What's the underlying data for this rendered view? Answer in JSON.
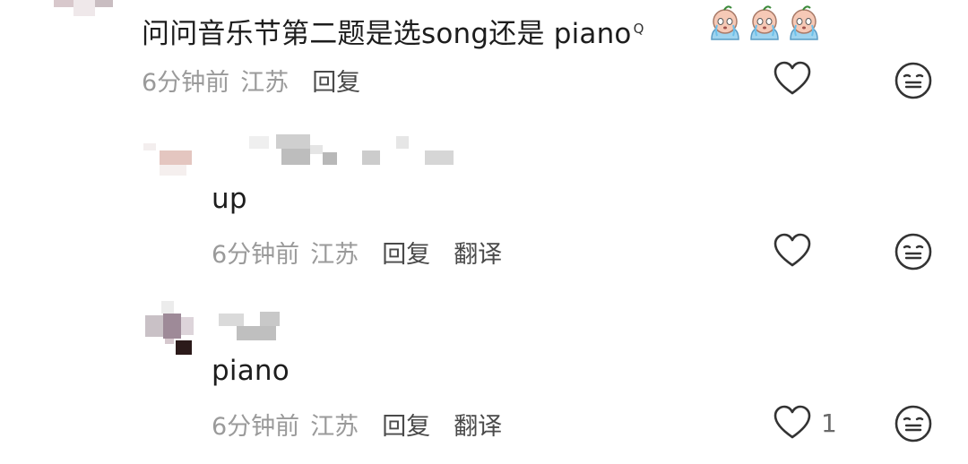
{
  "comments": [
    {
      "text": "问问音乐节第二题是选song还是 piano",
      "search_glyph": "Q",
      "emojis": [
        "crying-baby-emoji",
        "crying-baby-emoji",
        "crying-baby-emoji"
      ],
      "time": "6分钟前",
      "location": "江苏",
      "reply": "回复",
      "like_count": ""
    },
    {
      "text": "up",
      "time": "6分钟前",
      "location": "江苏",
      "reply": "回复",
      "translate": "翻译",
      "like_count": ""
    },
    {
      "text": "piano",
      "time": "6分钟前",
      "location": "江苏",
      "reply": "回复",
      "translate": "翻译",
      "like_count": "1"
    }
  ],
  "icons": {
    "like": "heart-outline-icon",
    "dislike": "meh-face-icon"
  },
  "colors": {
    "meta": "#9a9a9a",
    "text": "#1d1d1d",
    "icon": "#333333"
  }
}
